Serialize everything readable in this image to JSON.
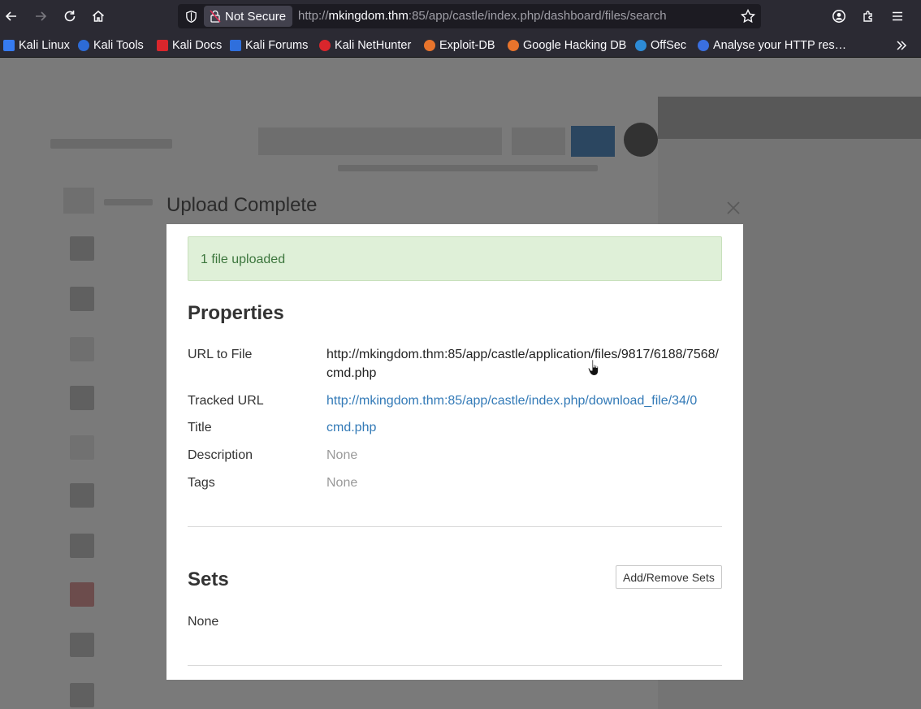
{
  "browser": {
    "security_label": "Not Secure",
    "url_prefix": "http://",
    "url_host": "mkingdom.thm",
    "url_rest": ":85/app/castle/index.php/dashboard/files/search",
    "bookmarks": [
      {
        "label": "Kali Linux",
        "icon": "kali-dragon-icon",
        "color": "#367bf0"
      },
      {
        "label": "Kali Tools",
        "icon": "kali-tools-icon",
        "color": "#2d6bd6"
      },
      {
        "label": "Kali Docs",
        "icon": "kali-docs-icon",
        "color": "#d9262c"
      },
      {
        "label": "Kali Forums",
        "icon": "kali-forums-icon",
        "color": "#2f6fdc"
      },
      {
        "label": "Kali NetHunter",
        "icon": "kali-nethunter-icon",
        "color": "#d9262c"
      },
      {
        "label": "Exploit-DB",
        "icon": "exploit-db-icon",
        "color": "#e8742c"
      },
      {
        "label": "Google Hacking DB",
        "icon": "ghdb-icon",
        "color": "#e8742c"
      },
      {
        "label": "OffSec",
        "icon": "offsec-icon",
        "color": "#2d8bd6"
      },
      {
        "label": "Analyse your HTTP res…",
        "icon": "http-analyse-icon",
        "color": "#3a6fe0"
      }
    ]
  },
  "modal": {
    "title": "Upload Complete",
    "alert": "1 file uploaded",
    "properties_heading": "Properties",
    "rows": {
      "url_label": "URL to File",
      "url_value": "http://mkingdom.thm:85/app/castle/application/files/9817/6188/7568/cmd.php",
      "tracked_label": "Tracked URL",
      "tracked_value": "http://mkingdom.thm:85/app/castle/index.php/download_file/34/0",
      "title_label": "Title",
      "title_value": "cmd.php",
      "description_label": "Description",
      "description_value": "None",
      "tags_label": "Tags",
      "tags_value": "None"
    },
    "sets_heading": "Sets",
    "sets_button": "Add/Remove Sets",
    "sets_value": "None"
  },
  "colors": {
    "success_bg": "#dff0d8",
    "success_text": "#3c763d",
    "link": "#337ab7",
    "chrome_bg": "#2b2a33"
  }
}
